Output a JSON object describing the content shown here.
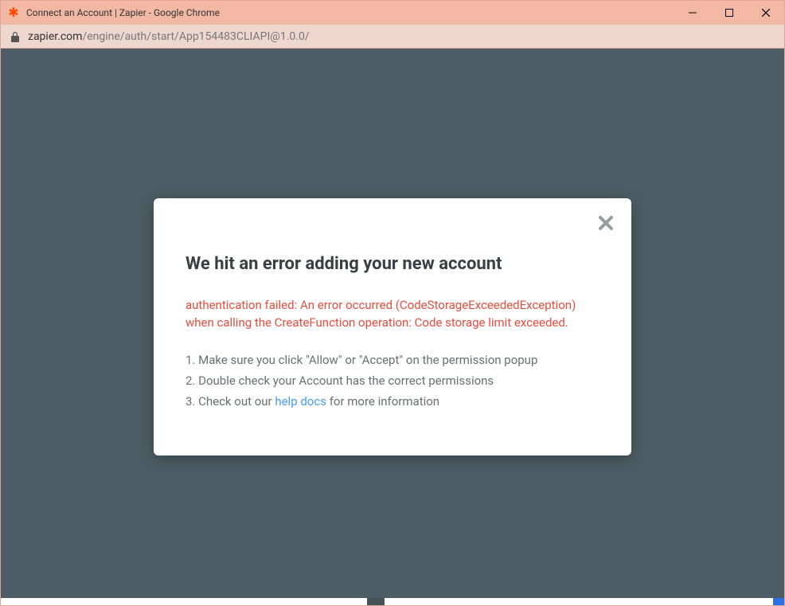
{
  "window": {
    "title": "Connect an Account | Zapier - Google Chrome"
  },
  "addressbar": {
    "domain": "zapier.com",
    "path": "/engine/auth/start/App154483CLIAPI@1.0.0/"
  },
  "modal": {
    "title": "We hit an error adding your new account",
    "error_message": "authentication failed: An error occurred (CodeStorageExceededException) when calling the CreateFunction operation: Code storage limit exceeded.",
    "step1": "1. Make sure you click \"Allow\" or \"Accept\" on the permission popup",
    "step2": "2. Double check your Account has the correct permissions",
    "step3_prefix": "3. Check out our ",
    "step3_link": "help docs",
    "step3_suffix": " for more information"
  }
}
